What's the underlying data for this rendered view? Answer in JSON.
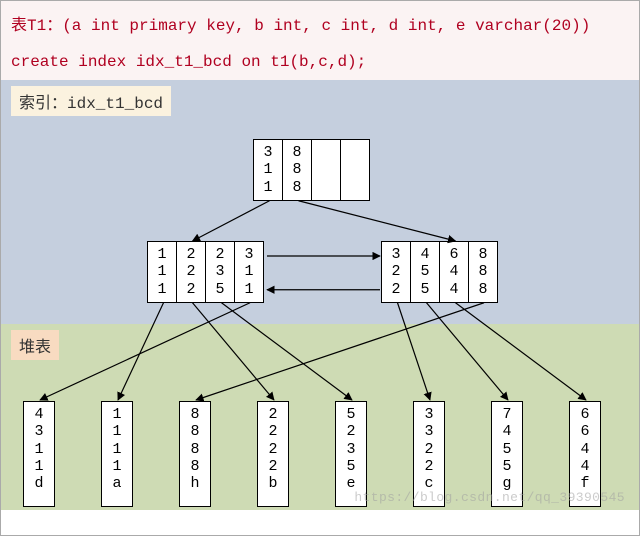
{
  "code": {
    "table_decl": "表T1：(a int primary key, b int, c int, d int, e varchar(20))",
    "create_stmt": "create index idx_t1_bcd on t1(b,c,d);"
  },
  "index": {
    "title": "索引：idx_t1_bcd"
  },
  "heap": {
    "title": "堆表"
  },
  "root": {
    "cells": [
      [
        "3",
        "1",
        "1"
      ],
      [
        "8",
        "8",
        "8"
      ],
      [],
      []
    ]
  },
  "leftLeaf": {
    "cells": [
      [
        "1",
        "1",
        "1"
      ],
      [
        "2",
        "2",
        "2"
      ],
      [
        "2",
        "3",
        "5"
      ],
      [
        "3",
        "1",
        "1"
      ]
    ]
  },
  "rightLeaf": {
    "cells": [
      [
        "3",
        "2",
        "2"
      ],
      [
        "4",
        "5",
        "5"
      ],
      [
        "6",
        "4",
        "4"
      ],
      [
        "8",
        "8",
        "8"
      ]
    ]
  },
  "heapRow": [
    [
      "4",
      "3",
      "1",
      "1",
      "d"
    ],
    [
      "1",
      "1",
      "1",
      "1",
      "a"
    ],
    [
      "8",
      "8",
      "8",
      "8",
      "h"
    ],
    [
      "2",
      "2",
      "2",
      "2",
      "b"
    ],
    [
      "5",
      "2",
      "3",
      "5",
      "e"
    ],
    [
      "3",
      "3",
      "2",
      "2",
      "c"
    ],
    [
      "7",
      "4",
      "5",
      "5",
      "g"
    ],
    [
      "6",
      "6",
      "4",
      "4",
      "f"
    ]
  ],
  "chart_data": {
    "type": "table",
    "title": "B-tree index idx_t1_bcd on t1(b,c,d) and heap rows of t1(a,b,c,d,e)",
    "btree_root": [
      [
        3,
        1,
        1
      ],
      [
        8,
        8,
        8
      ],
      null,
      null
    ],
    "btree_leaves": [
      [
        [
          1,
          1,
          1
        ],
        [
          2,
          2,
          2
        ],
        [
          2,
          3,
          5
        ],
        [
          3,
          1,
          1
        ]
      ],
      [
        [
          3,
          2,
          2
        ],
        [
          4,
          5,
          5
        ],
        [
          6,
          4,
          4
        ],
        [
          8,
          8,
          8
        ]
      ]
    ],
    "heap_rows": [
      {
        "a": 4,
        "b": 3,
        "c": 1,
        "d": 1,
        "e": "d"
      },
      {
        "a": 1,
        "b": 1,
        "c": 1,
        "d": 1,
        "e": "a"
      },
      {
        "a": 8,
        "b": 8,
        "c": 8,
        "d": 8,
        "e": "h"
      },
      {
        "a": 2,
        "b": 2,
        "c": 2,
        "d": 2,
        "e": "b"
      },
      {
        "a": 5,
        "b": 2,
        "c": 3,
        "d": 5,
        "e": "e"
      },
      {
        "a": 3,
        "b": 3,
        "c": 2,
        "d": 2,
        "e": "c"
      },
      {
        "a": 7,
        "b": 4,
        "c": 5,
        "d": 5,
        "e": "g"
      },
      {
        "a": 6,
        "b": 6,
        "c": 4,
        "d": 4,
        "e": "f"
      }
    ],
    "index_to_heap": {
      "left": [
        [
          0,
          1
        ],
        [
          1,
          3
        ],
        [
          2,
          4
        ],
        [
          3,
          0
        ]
      ],
      "right": [
        [
          0,
          5
        ],
        [
          1,
          6
        ],
        [
          2,
          7
        ],
        [
          3,
          2
        ]
      ]
    }
  },
  "watermark": "https://blog.csdn.net/qq_39390545"
}
